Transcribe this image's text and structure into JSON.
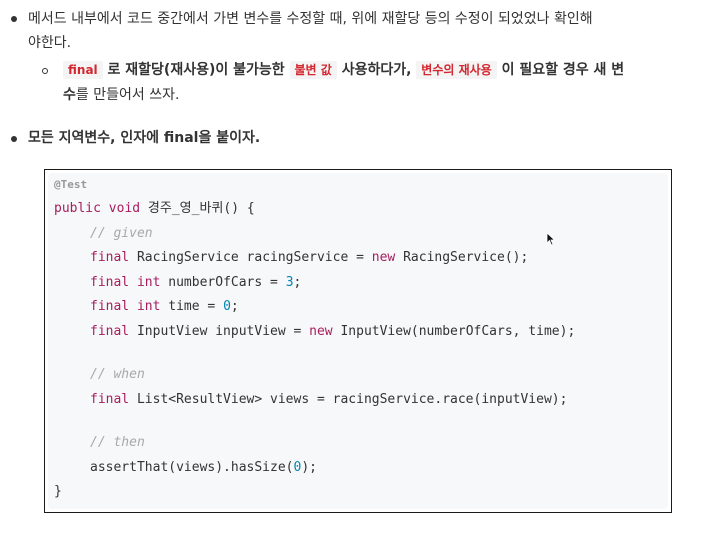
{
  "items": {
    "item1": {
      "line1": "메서드 내부에서 코드 중간에서 가변 변수를 수정할 때, 위에 재할당 등의 수정이 되었었나 확인해",
      "line2": "야한다."
    },
    "subitem": {
      "tag_final": "final",
      "text_a": " 로 재할당(재사용)이 불가능한 ",
      "tag_immutable": "불변 값",
      "text_b": " 사용하다가, ",
      "tag_reuse": "변수의 재사용",
      "text_c": " 이 필요할 경우 새 변",
      "line2_bold": "수",
      "line2_rest": "를 만들어서 쓰자."
    },
    "item2": "모든 지역변수, 인자에 final을 붙이자."
  },
  "code": {
    "annotation": "@Test",
    "l1_kw1": "public",
    "l1_kw2": "void",
    "l1_rest": " 경주_영_바퀴() {",
    "c_given": "// given",
    "l3_kw": "final",
    "l3_a": " RacingService racingService = ",
    "l3_new": "new",
    "l3_b": " RacingService();",
    "l4_kw": "final",
    "l4_type": "int",
    "l4_a": " numberOfCars = ",
    "l4_num": "3",
    "l4_b": ";",
    "l5_kw": "final",
    "l5_type": "int",
    "l5_a": " time = ",
    "l5_num": "0",
    "l5_b": ";",
    "l6_kw": "final",
    "l6_a": " InputView inputView = ",
    "l6_new": "new",
    "l6_b": " InputView(numberOfCars, time);",
    "c_when": "// when",
    "l8_kw": "final",
    "l8_a": " List<ResultView> views = racingService.race(inputView);",
    "c_then": "// then",
    "l10_a": "assertThat(views).hasSize(",
    "l10_num": "0",
    "l10_b": ");",
    "close": "}"
  }
}
